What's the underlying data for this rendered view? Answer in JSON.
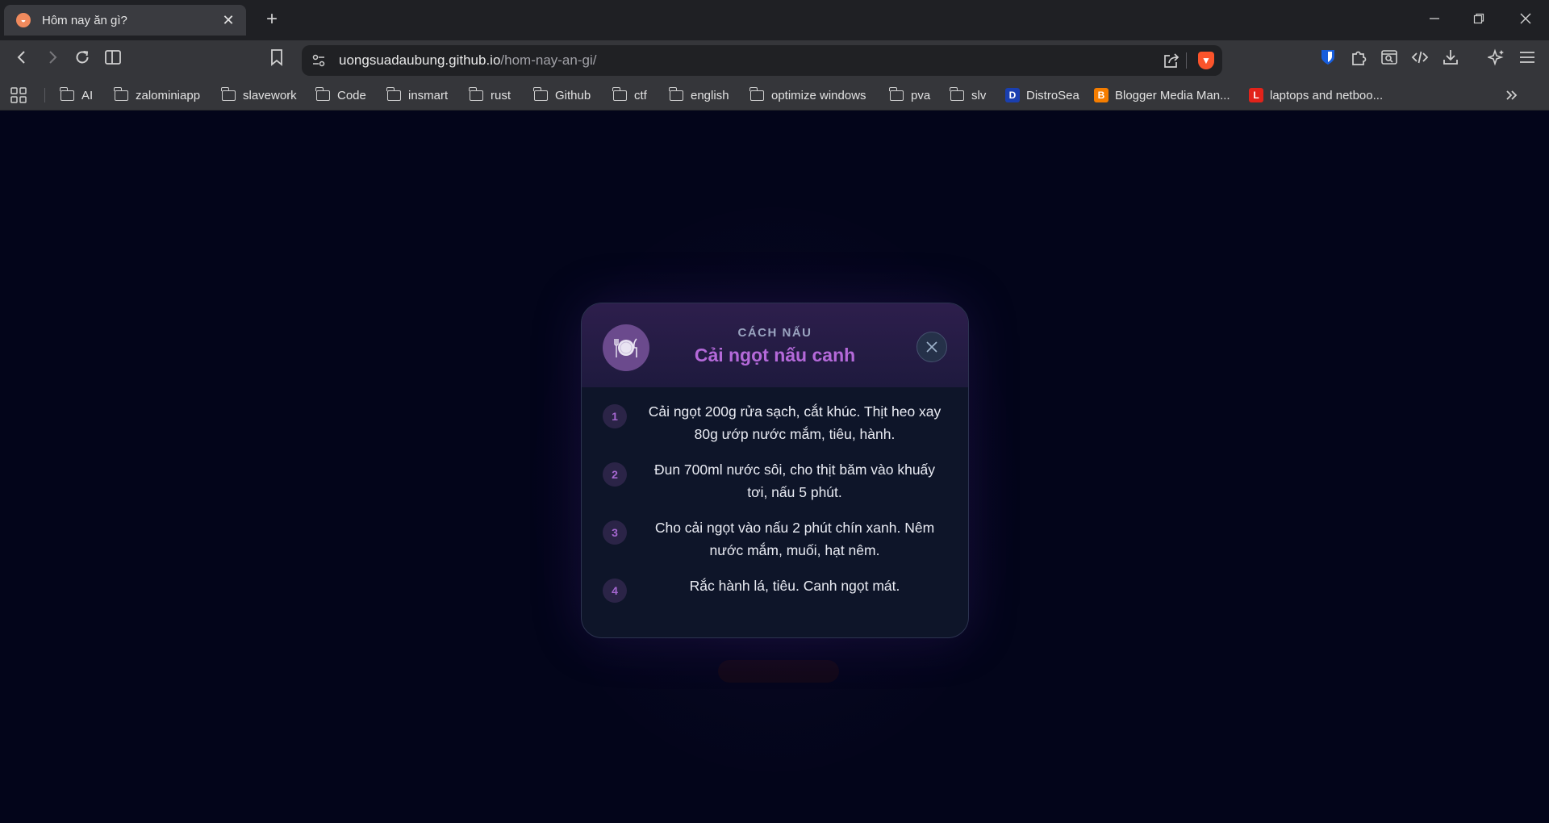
{
  "browser": {
    "tab": {
      "title": "Hôm nay ăn gì?",
      "favicon": "bowl-icon",
      "close": "✕"
    },
    "new_tab": "+",
    "window_controls": {
      "minimize": "—",
      "restore": "❐",
      "close": "✕"
    },
    "address": {
      "host": "uongsuadaubung.github.io",
      "path": "/hom-nay-an-gi/"
    }
  },
  "bookmarks": [
    {
      "label": "AI",
      "icon": "folder-icon"
    },
    {
      "label": "zalominiapp",
      "icon": "folder-icon"
    },
    {
      "label": "slavework",
      "icon": "folder-icon"
    },
    {
      "label": "Code",
      "icon": "folder-icon"
    },
    {
      "label": "insmart",
      "icon": "folder-icon"
    },
    {
      "label": "rust",
      "icon": "folder-icon"
    },
    {
      "label": "Github",
      "icon": "folder-icon"
    },
    {
      "label": "ctf",
      "icon": "folder-icon"
    },
    {
      "label": "english",
      "icon": "folder-icon"
    },
    {
      "label": "optimize windows",
      "icon": "folder-icon"
    },
    {
      "label": "pva",
      "icon": "folder-icon"
    },
    {
      "label": "slv",
      "icon": "folder-icon"
    },
    {
      "label": "DistroSea",
      "icon": "distrosea-icon",
      "glyph": "D",
      "color": "#1a3fb0"
    },
    {
      "label": "Blogger Media Man...",
      "icon": "blogger-icon",
      "glyph": "B",
      "color": "#f57d00"
    },
    {
      "label": "laptops and netboo...",
      "icon": "lenovo-icon",
      "glyph": "L",
      "color": "#e2231a"
    }
  ],
  "modal": {
    "kicker": "CÁCH NẤU",
    "title": "Cải ngọt nấu canh",
    "steps": [
      {
        "n": "1",
        "text": "Cải ngọt 200g rửa sạch, cắt khúc. Thịt heo xay 80g ướp nước mắm, tiêu, hành."
      },
      {
        "n": "2",
        "text": "Đun 700ml nước sôi, cho thịt băm vào khuấy tơi, nấu 5 phút."
      },
      {
        "n": "3",
        "text": "Cho cải ngọt vào nấu 2 phút chín xanh. Nêm nước mắm, muối, hạt nêm."
      },
      {
        "n": "4",
        "text": "Rắc hành lá, tiêu. Canh ngọt mát."
      }
    ]
  },
  "colors": {
    "accent": "#b469d9",
    "background": "#03051a",
    "modal": "#0e1529"
  }
}
